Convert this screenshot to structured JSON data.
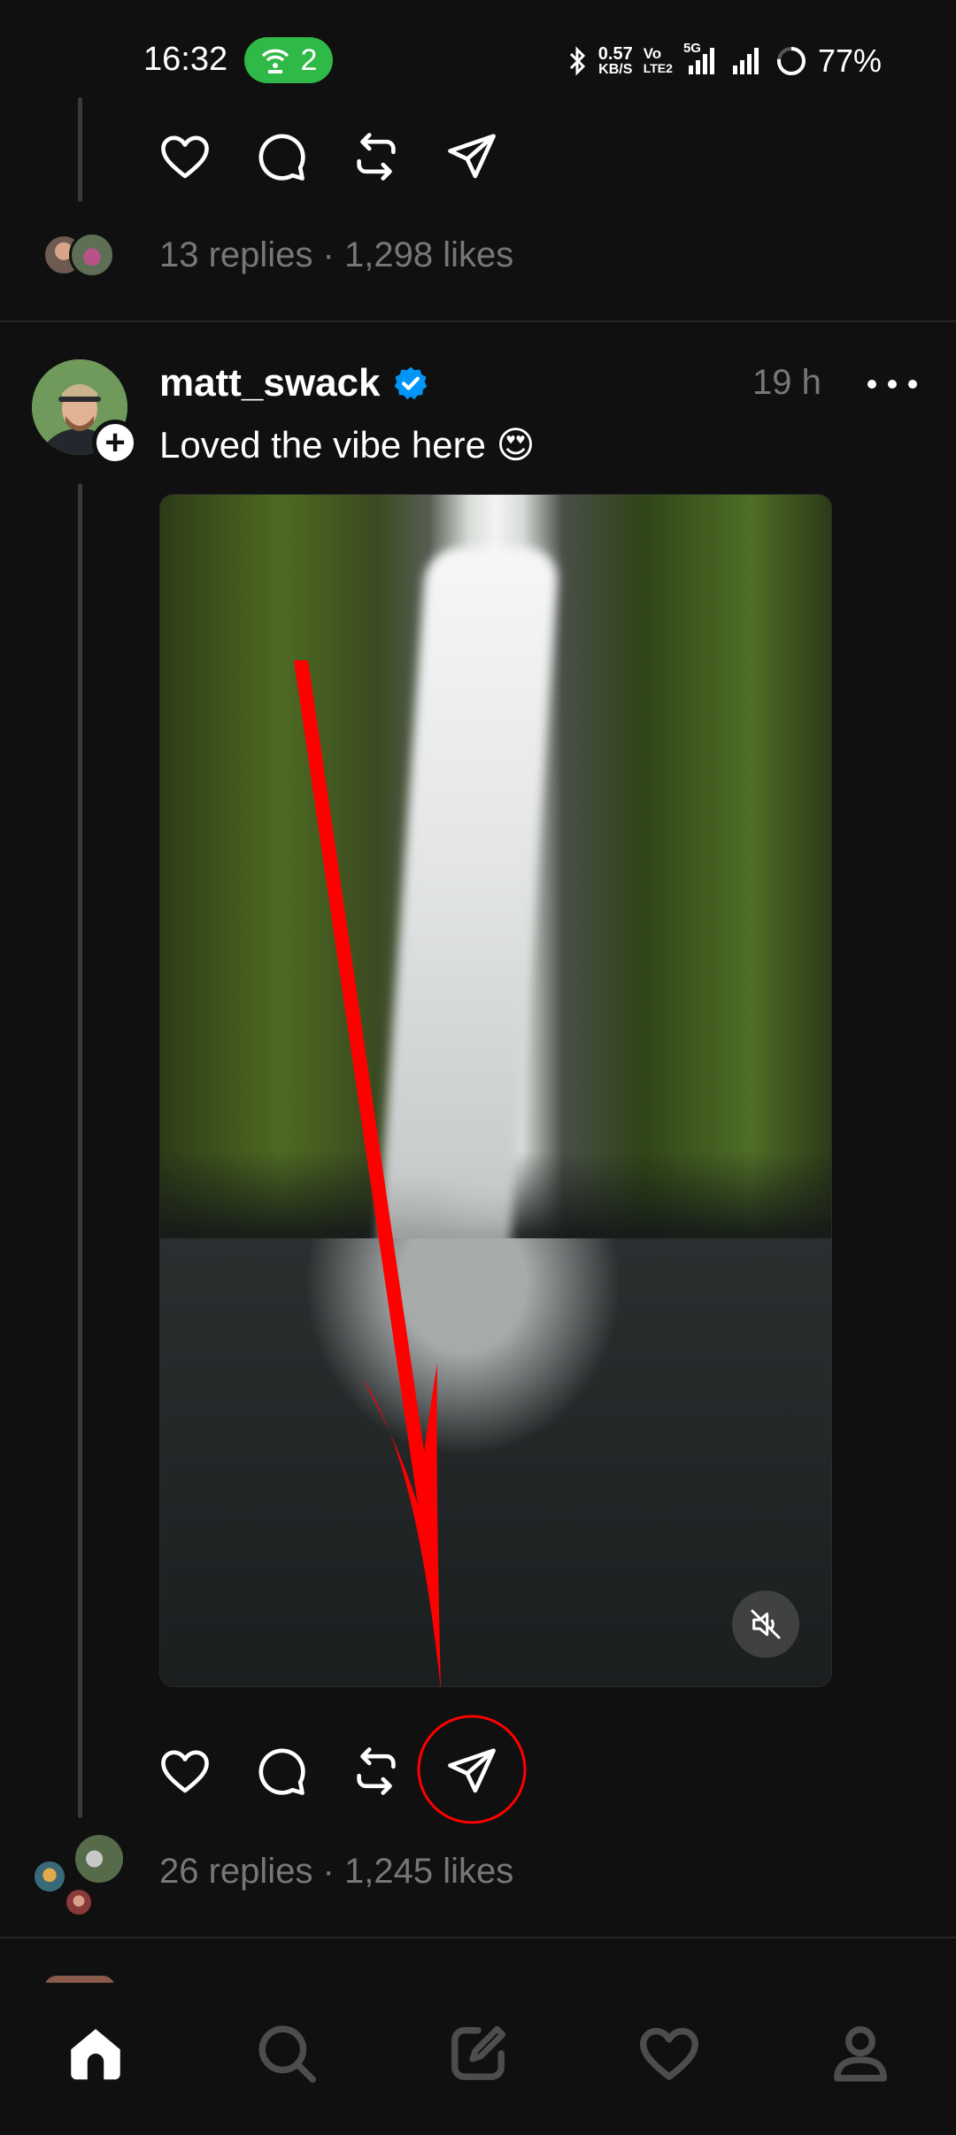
{
  "status_bar": {
    "time": "16:32",
    "hotspot_count": "2",
    "net_speed_value": "0.57",
    "net_speed_unit": "KB/S",
    "volte_top": "Vo",
    "volte_bottom": "LTE2",
    "network_type": "5G",
    "battery": "77%"
  },
  "previous_post": {
    "stats": "13 replies · 1,298 likes"
  },
  "post": {
    "username": "matt_swack",
    "time_ago": "19 h",
    "caption": "Loved the vibe here 😍",
    "stats": "26 replies · 1,245 likes"
  },
  "icons": {
    "like": "heart-icon",
    "reply": "comment-icon",
    "repost": "repost-icon",
    "share": "send-icon",
    "mute": "speaker-muted-icon",
    "home": "home-icon",
    "search": "search-icon",
    "compose": "compose-icon",
    "activity": "heart-icon",
    "profile": "profile-icon"
  },
  "colors": {
    "background": "#101010",
    "verified": "#0095f6",
    "annotation": "#ff0000",
    "hotspot": "#2fb946"
  }
}
